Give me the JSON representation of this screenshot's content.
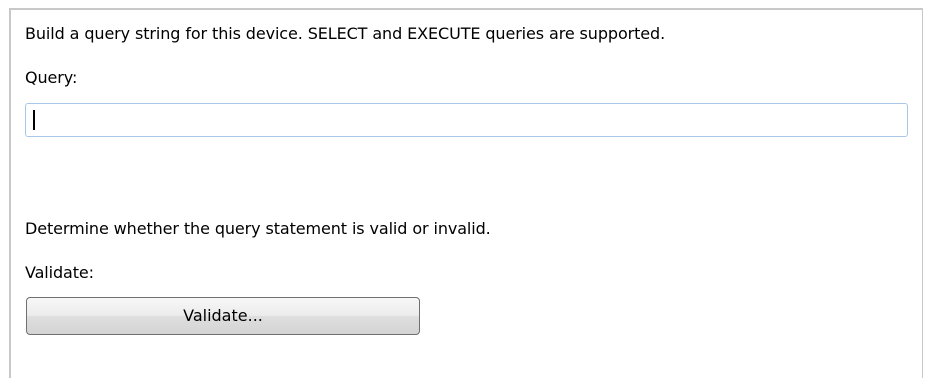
{
  "query_section": {
    "description": "Build a query string for this device. SELECT and EXECUTE queries are supported.",
    "label": "Query:",
    "input_value": "",
    "input_placeholder": ""
  },
  "validate_section": {
    "description": "Determine whether the query statement is valid or invalid.",
    "label": "Validate:",
    "button_label": "Validate..."
  },
  "colors": {
    "input_border": "#a9c7e8",
    "panel_border": "#c8c8c8",
    "button_border": "#707070"
  }
}
